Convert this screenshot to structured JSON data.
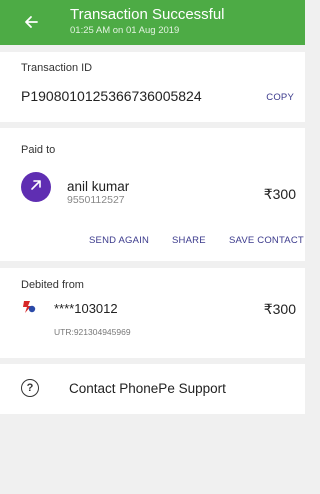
{
  "header": {
    "title": "Transaction Successful",
    "subtitle": "01:25 AM on 01 Aug 2019",
    "color": "#4dab45"
  },
  "transaction": {
    "label": "Transaction ID",
    "id": "P1908010125366736005824",
    "copy_label": "COPY"
  },
  "paid_to": {
    "label": "Paid to",
    "name": "anil kumar",
    "phone": "9550112527",
    "amount": "₹300",
    "actions": {
      "send_again": "SEND AGAIN",
      "share": "SHARE",
      "save_contact": "SAVE CONTACT"
    },
    "avatar_icon": "arrow-up-right-icon",
    "avatar_color": "#5f2eb2"
  },
  "debited_from": {
    "label": "Debited from",
    "account": "****103012",
    "amount": "₹300",
    "utr": "UTR:921304945969",
    "bank_icon": "bank-logo-icon"
  },
  "support": {
    "label": "Contact PhonePe Support",
    "icon": "help-icon"
  }
}
